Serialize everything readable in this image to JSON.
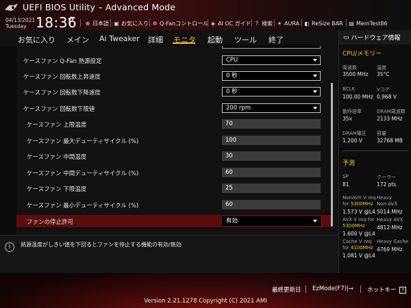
{
  "header": {
    "title": "UEFI BIOS Utility – Advanced Mode",
    "date": "04/13/2021",
    "day": "Tuesday",
    "time": "18:36",
    "toolbar": [
      {
        "label": "日本語",
        "icon": "globe-icon"
      },
      {
        "label": "お気に入り",
        "icon": "favorites-icon"
      },
      {
        "label": "Q-Fanコントロール",
        "icon": "fan-icon"
      },
      {
        "label": "AI OC ガイド",
        "icon": "ai-oc-icon"
      },
      {
        "label": "検索",
        "icon": "help-icon"
      },
      {
        "label": "AURA",
        "icon": "aura-icon"
      },
      {
        "label": "ReSize BAR",
        "icon": "resize-bar-icon"
      },
      {
        "label": "MemTest86",
        "icon": "memtest-icon"
      }
    ]
  },
  "nav": {
    "items": [
      "お気に入り",
      "メイン",
      "Ai Tweaker",
      "詳細",
      "モニタ",
      "起動",
      "ツール",
      "終了"
    ],
    "active": "モニタ"
  },
  "settings": [
    {
      "label": "ケースファン Q-Fan 熱源設定",
      "type": "dropdown",
      "value": "CPU"
    },
    {
      "label": "ケースファン 回転数上昇速度",
      "type": "dropdown",
      "value": "0 秒"
    },
    {
      "label": "ケースファン 回転数下降速度",
      "type": "dropdown",
      "value": "0 秒"
    },
    {
      "label": "ケースファン 回転数下限値",
      "type": "dropdown",
      "value": "200 rpm"
    },
    {
      "label": "ケースファン 上限温度",
      "type": "field",
      "value": "70"
    },
    {
      "label": "ケースファン 最大デューティサイクル (%)",
      "type": "field",
      "value": "100"
    },
    {
      "label": "ケースファン 中間温度",
      "type": "field",
      "value": "30"
    },
    {
      "label": "ケースファン 中間デューティサイクル (%)",
      "type": "field",
      "value": "60"
    },
    {
      "label": "ケースファン 下限温度",
      "type": "field",
      "value": "25"
    },
    {
      "label": "ケースファン 最小デューティサイクル (%)",
      "type": "field",
      "value": "60"
    },
    {
      "label": "ファンの停止許可",
      "type": "dropdown",
      "value": "有効"
    }
  ],
  "help": {
    "text": "熱源温度がしきい値を下回るとファンを停止する機能の有効/無効"
  },
  "hw": {
    "title": "ハードウェア情報",
    "cpu_section": "CPU/メモリー",
    "freq_label": "周波数",
    "freq_value": "3500 MHz",
    "temp_label": "温度",
    "temp_value": "35°C",
    "bclk_label": "BCLK",
    "bclk_value": "100.00 MHz",
    "vcore_label": "Vコア",
    "vcore_value": "0.968 V",
    "ratio_label": "動作倍率",
    "ratio_value": "35x",
    "dram_freq_label": "DRAM周波数",
    "dram_freq_value": "2133 MHz",
    "dram_volt_label": "DRAM電圧",
    "dram_volt_value": "1.200 V",
    "capacity_label": "容量",
    "capacity_value": "32768 MB",
    "pred_section": "予測",
    "sp_label": "SP",
    "sp_value": "81",
    "cooler_label": "クーラー",
    "cooler_value": "172 pts",
    "nonavx_label_1": "NonAVX V req",
    "nonavx_label_2": "for",
    "nonavx_freq": "5300MHz",
    "heavy_nonavx_label_1": "Heavy",
    "heavy_nonavx_label_2": "Non-AVX",
    "nonavx_volt": "1.573 V @L4",
    "heavy_nonavx_value": "5014 MHz",
    "avx_label_1": "AVX V req",
    "avx_label_2": "for",
    "avx_freq": "5300MHz",
    "heavy_avx_label": "Heavy AVX",
    "avx_volt": "1.600 V @L4",
    "heavy_avx_value": "4812 MHz",
    "cache_label_1": "Cache V req",
    "cache_label_2": "for",
    "cache_freq": "4100MHz",
    "heavy_cache_label": "Heavy Cache",
    "cache_volt": "1.081 V @L4",
    "heavy_cache_value": "4769 MHz"
  },
  "footer": {
    "last_modified": "最終更新日",
    "ezmode": "EzMode(F7)|→",
    "hotkey": "ホットキー",
    "version": "Version 2.21.1278 Copyright (C) 2021 AMI"
  },
  "colors": {
    "accent": "#f5c23a",
    "highlight_row": "#5a0c0c",
    "brand_red": "#7a1010"
  }
}
